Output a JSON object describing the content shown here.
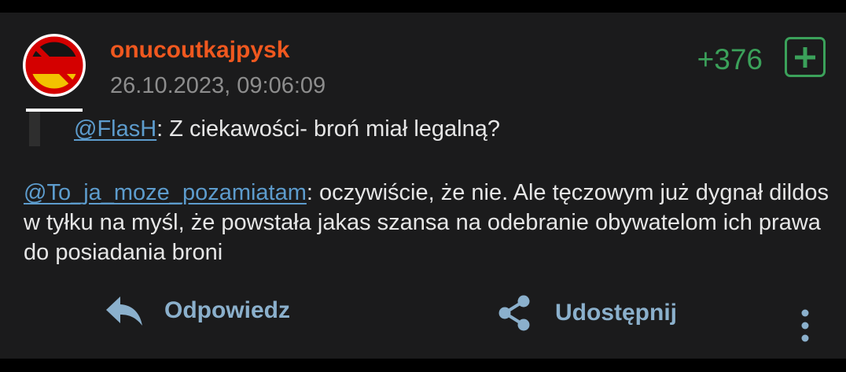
{
  "post": {
    "author": "onucoutkajpysk",
    "timestamp": "26.10.2023, 09:06:09",
    "votes": "+376",
    "quote": {
      "mention": "@FlasH",
      "text": ": Z ciekawości- broń miał legalną?"
    },
    "body": {
      "mention": "@To_ja_moze_pozamiatam",
      "text": ": oczywiście, że nie. Ale tęczowym już dygnał dildos w tyłku na myśl, że powstała jakas szansa na odebranie obywatelom ich prawa do posiadania broni"
    }
  },
  "actions": {
    "reply_label": "Odpowiedz",
    "share_label": "Udostępnij"
  },
  "icons": {
    "avatar": "crossed-out-german-flag-avatar",
    "upvote": "plus-icon",
    "reply": "reply-arrow-icon",
    "share": "share-icon",
    "more": "more-vertical-icon"
  },
  "colors": {
    "background": "#1b1b1c",
    "author": "#f0581f",
    "votes": "#3ba15a",
    "mention": "#5d9ccd",
    "action": "#8bb0cc",
    "timestamp": "#8d8d8d"
  }
}
